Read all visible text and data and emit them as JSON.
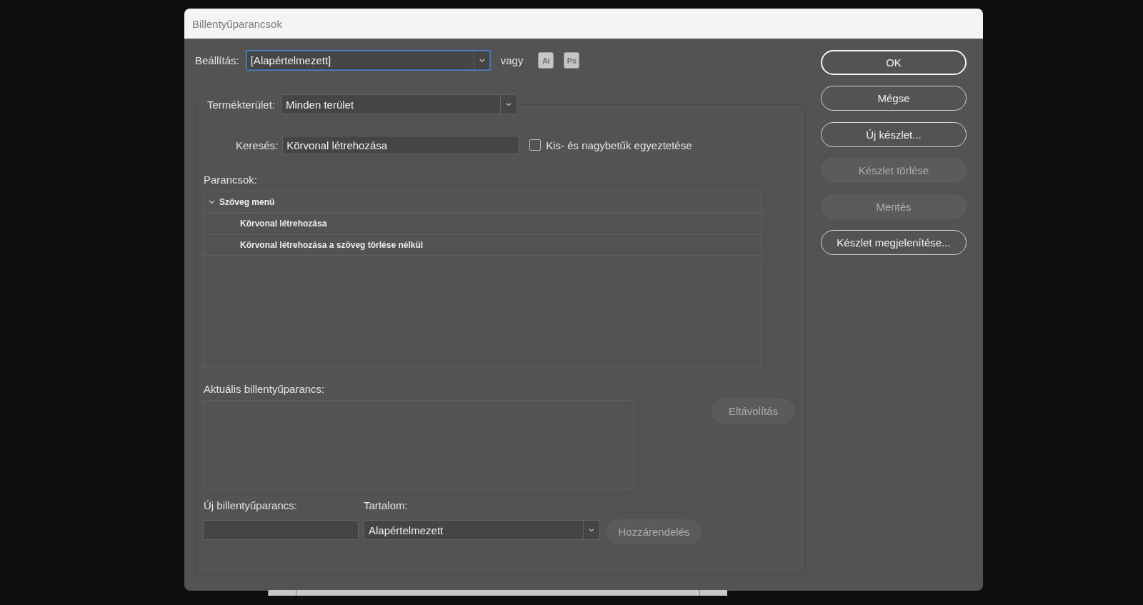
{
  "window": {
    "title": "Billentyűparancsok"
  },
  "set": {
    "label": "Beállítás:",
    "value": "[Alapértelmezett]",
    "focused": true
  },
  "or_label": "vagy",
  "app_buttons": [
    {
      "label": "Ai"
    },
    {
      "label": "Ps"
    }
  ],
  "product_area": {
    "label": "Termékterület:",
    "value": "Minden terület"
  },
  "search": {
    "label": "Keresés:",
    "value": "Körvonal létrehozása"
  },
  "match_case": {
    "label": "Kis- és nagybetűk egyeztetése",
    "checked": false
  },
  "commands": {
    "label": "Parancsok:",
    "items": [
      {
        "label": "Szöveg menü",
        "expanded": true,
        "selected": false,
        "children": [
          {
            "label": "Körvonal létrehozása",
            "selected": false
          },
          {
            "label": "Körvonal létrehozása a szöveg törlése nélkül",
            "selected": false
          }
        ]
      }
    ]
  },
  "current_shortcut": {
    "label": "Aktuális billentyűparancs:",
    "remove_button": {
      "label": "Eltávolítás",
      "disabled": true
    }
  },
  "new_shortcut": {
    "label": "Új billentyűparancs:"
  },
  "context": {
    "label": "Tartalom:",
    "value": "Alapértelmezett"
  },
  "assign_button": {
    "label": "Hozzárendelés",
    "disabled": true
  },
  "buttons": [
    {
      "label": "OK",
      "default": true,
      "disabled": false
    },
    {
      "label": "Mégse",
      "default": false,
      "disabled": false
    },
    {
      "label": "Új készlet...",
      "default": false,
      "disabled": false
    },
    {
      "label": "Készlet törlése",
      "default": false,
      "disabled": true
    },
    {
      "label": "Mentés",
      "default": false,
      "disabled": true
    },
    {
      "label": "Készlet megjelenítése...",
      "default": false,
      "disabled": false
    }
  ]
}
